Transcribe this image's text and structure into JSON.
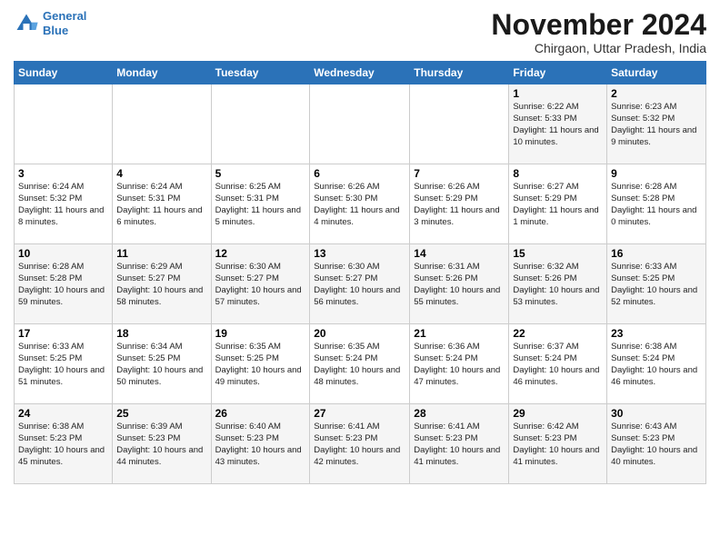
{
  "logo": {
    "line1": "General",
    "line2": "Blue"
  },
  "title": "November 2024",
  "subtitle": "Chirgaon, Uttar Pradesh, India",
  "headers": [
    "Sunday",
    "Monday",
    "Tuesday",
    "Wednesday",
    "Thursday",
    "Friday",
    "Saturday"
  ],
  "weeks": [
    [
      {
        "day": "",
        "content": ""
      },
      {
        "day": "",
        "content": ""
      },
      {
        "day": "",
        "content": ""
      },
      {
        "day": "",
        "content": ""
      },
      {
        "day": "",
        "content": ""
      },
      {
        "day": "1",
        "content": "Sunrise: 6:22 AM\nSunset: 5:33 PM\nDaylight: 11 hours and 10 minutes."
      },
      {
        "day": "2",
        "content": "Sunrise: 6:23 AM\nSunset: 5:32 PM\nDaylight: 11 hours and 9 minutes."
      }
    ],
    [
      {
        "day": "3",
        "content": "Sunrise: 6:24 AM\nSunset: 5:32 PM\nDaylight: 11 hours and 8 minutes."
      },
      {
        "day": "4",
        "content": "Sunrise: 6:24 AM\nSunset: 5:31 PM\nDaylight: 11 hours and 6 minutes."
      },
      {
        "day": "5",
        "content": "Sunrise: 6:25 AM\nSunset: 5:31 PM\nDaylight: 11 hours and 5 minutes."
      },
      {
        "day": "6",
        "content": "Sunrise: 6:26 AM\nSunset: 5:30 PM\nDaylight: 11 hours and 4 minutes."
      },
      {
        "day": "7",
        "content": "Sunrise: 6:26 AM\nSunset: 5:29 PM\nDaylight: 11 hours and 3 minutes."
      },
      {
        "day": "8",
        "content": "Sunrise: 6:27 AM\nSunset: 5:29 PM\nDaylight: 11 hours and 1 minute."
      },
      {
        "day": "9",
        "content": "Sunrise: 6:28 AM\nSunset: 5:28 PM\nDaylight: 11 hours and 0 minutes."
      }
    ],
    [
      {
        "day": "10",
        "content": "Sunrise: 6:28 AM\nSunset: 5:28 PM\nDaylight: 10 hours and 59 minutes."
      },
      {
        "day": "11",
        "content": "Sunrise: 6:29 AM\nSunset: 5:27 PM\nDaylight: 10 hours and 58 minutes."
      },
      {
        "day": "12",
        "content": "Sunrise: 6:30 AM\nSunset: 5:27 PM\nDaylight: 10 hours and 57 minutes."
      },
      {
        "day": "13",
        "content": "Sunrise: 6:30 AM\nSunset: 5:27 PM\nDaylight: 10 hours and 56 minutes."
      },
      {
        "day": "14",
        "content": "Sunrise: 6:31 AM\nSunset: 5:26 PM\nDaylight: 10 hours and 55 minutes."
      },
      {
        "day": "15",
        "content": "Sunrise: 6:32 AM\nSunset: 5:26 PM\nDaylight: 10 hours and 53 minutes."
      },
      {
        "day": "16",
        "content": "Sunrise: 6:33 AM\nSunset: 5:25 PM\nDaylight: 10 hours and 52 minutes."
      }
    ],
    [
      {
        "day": "17",
        "content": "Sunrise: 6:33 AM\nSunset: 5:25 PM\nDaylight: 10 hours and 51 minutes."
      },
      {
        "day": "18",
        "content": "Sunrise: 6:34 AM\nSunset: 5:25 PM\nDaylight: 10 hours and 50 minutes."
      },
      {
        "day": "19",
        "content": "Sunrise: 6:35 AM\nSunset: 5:25 PM\nDaylight: 10 hours and 49 minutes."
      },
      {
        "day": "20",
        "content": "Sunrise: 6:35 AM\nSunset: 5:24 PM\nDaylight: 10 hours and 48 minutes."
      },
      {
        "day": "21",
        "content": "Sunrise: 6:36 AM\nSunset: 5:24 PM\nDaylight: 10 hours and 47 minutes."
      },
      {
        "day": "22",
        "content": "Sunrise: 6:37 AM\nSunset: 5:24 PM\nDaylight: 10 hours and 46 minutes."
      },
      {
        "day": "23",
        "content": "Sunrise: 6:38 AM\nSunset: 5:24 PM\nDaylight: 10 hours and 46 minutes."
      }
    ],
    [
      {
        "day": "24",
        "content": "Sunrise: 6:38 AM\nSunset: 5:23 PM\nDaylight: 10 hours and 45 minutes."
      },
      {
        "day": "25",
        "content": "Sunrise: 6:39 AM\nSunset: 5:23 PM\nDaylight: 10 hours and 44 minutes."
      },
      {
        "day": "26",
        "content": "Sunrise: 6:40 AM\nSunset: 5:23 PM\nDaylight: 10 hours and 43 minutes."
      },
      {
        "day": "27",
        "content": "Sunrise: 6:41 AM\nSunset: 5:23 PM\nDaylight: 10 hours and 42 minutes."
      },
      {
        "day": "28",
        "content": "Sunrise: 6:41 AM\nSunset: 5:23 PM\nDaylight: 10 hours and 41 minutes."
      },
      {
        "day": "29",
        "content": "Sunrise: 6:42 AM\nSunset: 5:23 PM\nDaylight: 10 hours and 41 minutes."
      },
      {
        "day": "30",
        "content": "Sunrise: 6:43 AM\nSunset: 5:23 PM\nDaylight: 10 hours and 40 minutes."
      }
    ]
  ]
}
